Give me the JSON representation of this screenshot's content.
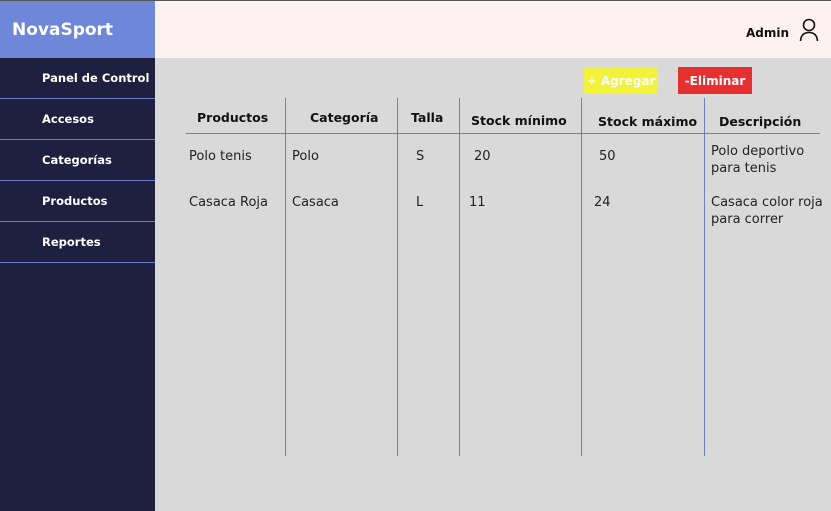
{
  "app": {
    "brand": "NovaSport"
  },
  "header": {
    "user_label": "Admin",
    "user_icon": "user-icon"
  },
  "sidebar": {
    "items": [
      {
        "label": "Panel de Control"
      },
      {
        "label": "Accesos"
      },
      {
        "label": "Categorías"
      },
      {
        "label": "Productos"
      },
      {
        "label": "Reportes"
      }
    ]
  },
  "actions": {
    "add_label": "+ Agregar",
    "delete_label": "-Eliminar"
  },
  "table": {
    "columns": [
      "Productos",
      "Categoría",
      "Talla",
      "Stock mínimo",
      "Stock máximo",
      "Descripción"
    ],
    "rows": [
      {
        "producto": "Polo tenis",
        "categoria": "Polo",
        "talla": "S",
        "stock_min": "20",
        "stock_max": "50",
        "descripcion": "Polo deportivo para tenis"
      },
      {
        "producto": "Casaca Roja",
        "categoria": "Casaca",
        "talla": "L",
        "stock_min": "11",
        "stock_max": "24",
        "descripcion": "Casaca color roja para correr"
      }
    ]
  },
  "colors": {
    "brand_bg": "#6f87d8",
    "sidebar_bg": "#1f1f3f",
    "header_bg": "#fdf2f1",
    "content_bg": "#d9d9d9",
    "add_button": "#f2f23a",
    "delete_button": "#e62f2f",
    "grid_lines": "#6a7fd0"
  }
}
